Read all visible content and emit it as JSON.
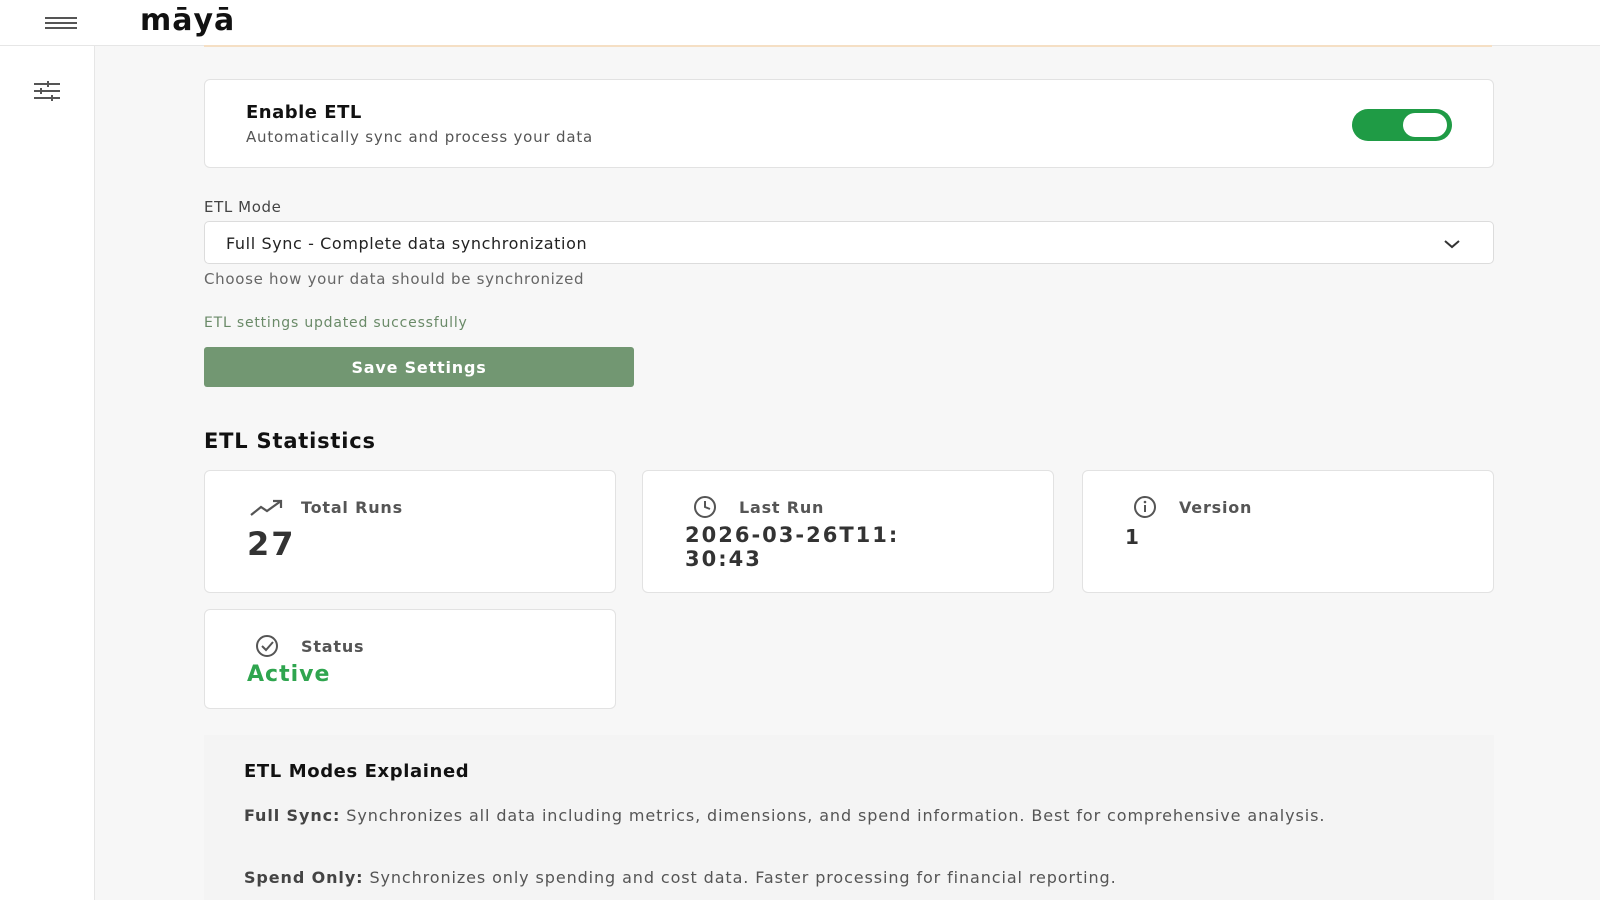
{
  "app": {
    "logo": "māyā"
  },
  "etl_toggle": {
    "title": "Enable ETL",
    "subtitle": "Automatically sync and process your data",
    "enabled": true,
    "on_color": "#1f9b45"
  },
  "etl_mode": {
    "label": "ETL Mode",
    "selected": "Full Sync - Complete data synchronization",
    "help": "Choose how your data should be synchronized"
  },
  "status_message": "ETL settings updated successfully",
  "save_button": {
    "label": "Save Settings",
    "color": "#729772"
  },
  "statistics": {
    "title": "ETL Statistics",
    "total_runs": {
      "label": "Total Runs",
      "value": "27",
      "icon": "trending-up-icon"
    },
    "last_run": {
      "label": "Last Run",
      "value": "2026-03-26T11:30:43",
      "icon": "clock-icon"
    },
    "version": {
      "label": "Version",
      "value": "1",
      "icon": "info-icon"
    },
    "status": {
      "label": "Status",
      "value": "Active",
      "icon": "check-circle-icon",
      "color": "#2fa54f"
    }
  },
  "modes_explained": {
    "title": "ETL Modes Explained",
    "full_sync": {
      "term": "Full Sync:",
      "text": " Synchronizes all data including metrics, dimensions, and spend information. Best for comprehensive analysis."
    },
    "spend_only": {
      "term": "Spend Only:",
      "text": " Synchronizes only spending and cost data. Faster processing for financial reporting."
    }
  },
  "icons": {
    "menu": "hamburger-menu-icon",
    "sidebar": "sliders-icon",
    "dropdown": "chevron-down-icon"
  }
}
